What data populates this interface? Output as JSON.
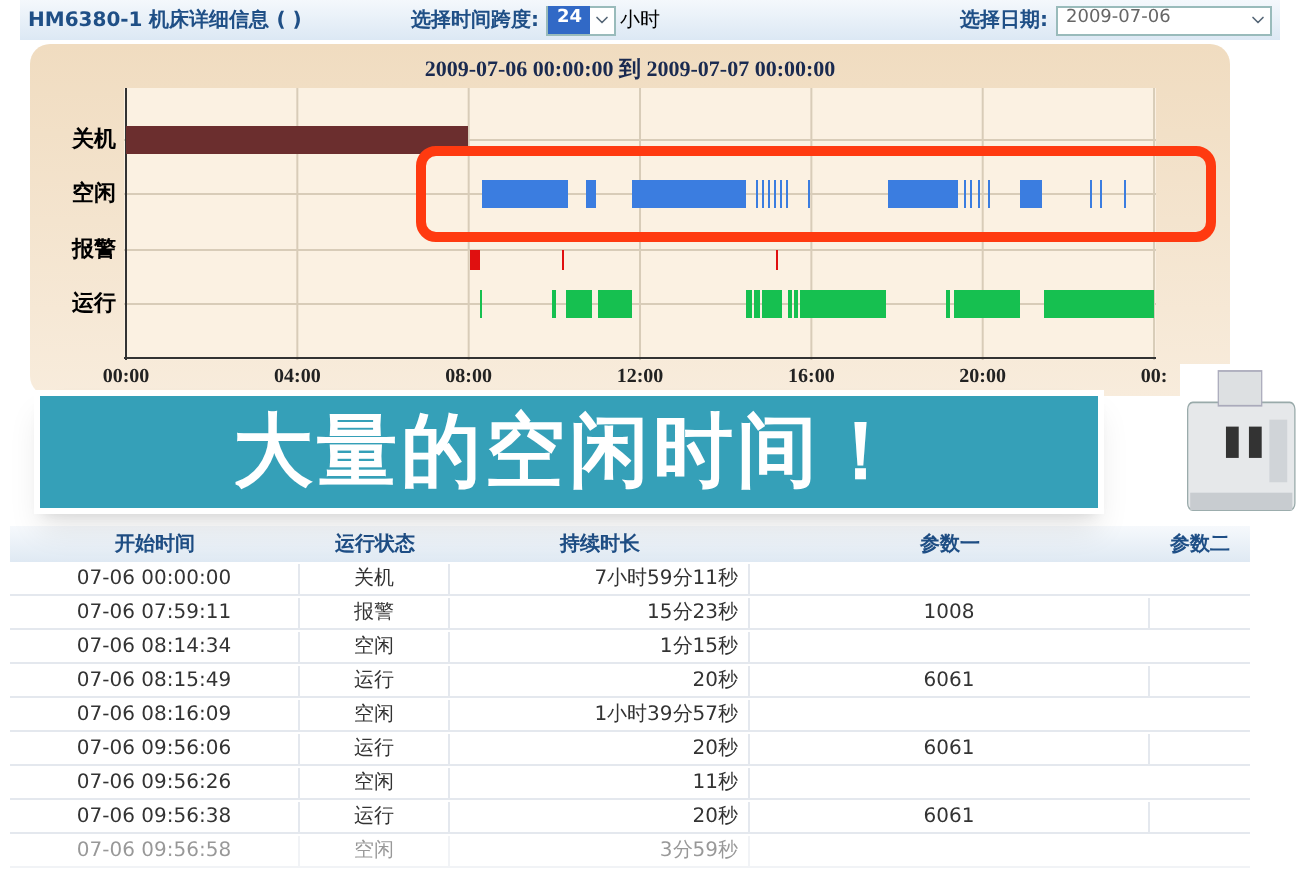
{
  "header": {
    "title": "HM6380-1 机床详细信息 ( )",
    "span_label": "选择时间跨度:",
    "span_value": "24",
    "span_unit": "小时",
    "date_label": "选择日期:",
    "date_value": "2009-07-06"
  },
  "chart": {
    "title": "2009-07-06 00:00:00 到 2009-07-07 00:00:00",
    "lanes": [
      {
        "label": "关机",
        "kind": "off"
      },
      {
        "label": "空闲",
        "kind": "idle"
      },
      {
        "label": "报警",
        "kind": "alarm"
      },
      {
        "label": "运行",
        "kind": "run"
      }
    ],
    "ticks": [
      "00:00",
      "04:00",
      "08:00",
      "12:00",
      "16:00",
      "20:00",
      "00:"
    ]
  },
  "banner": "大量的空闲时间！",
  "table": {
    "columns": [
      "开始时间",
      "运行状态",
      "持续时长",
      "参数一",
      "参数二"
    ],
    "rows": [
      {
        "start": "07-06 00:00:00",
        "state": "关机",
        "duration": "7小时59分11秒"
      },
      {
        "start": "07-06 07:59:11",
        "state": "报警",
        "duration": "15分23秒",
        "param1": "1008"
      },
      {
        "start": "07-06 08:14:34",
        "state": "空闲",
        "duration": "1分15秒"
      },
      {
        "start": "07-06 08:15:49",
        "state": "运行",
        "duration": "20秒",
        "param1": "6061"
      },
      {
        "start": "07-06 08:16:09",
        "state": "空闲",
        "duration": "1小时39分57秒"
      },
      {
        "start": "07-06 09:56:06",
        "state": "运行",
        "duration": "20秒",
        "param1": "6061"
      },
      {
        "start": "07-06 09:56:26",
        "state": "空闲",
        "duration": "11秒"
      },
      {
        "start": "07-06 09:56:38",
        "state": "运行",
        "duration": "20秒",
        "param1": "6061"
      },
      {
        "start": "07-06 09:56:58",
        "state": "空闲",
        "duration": "3分59秒"
      }
    ]
  }
}
